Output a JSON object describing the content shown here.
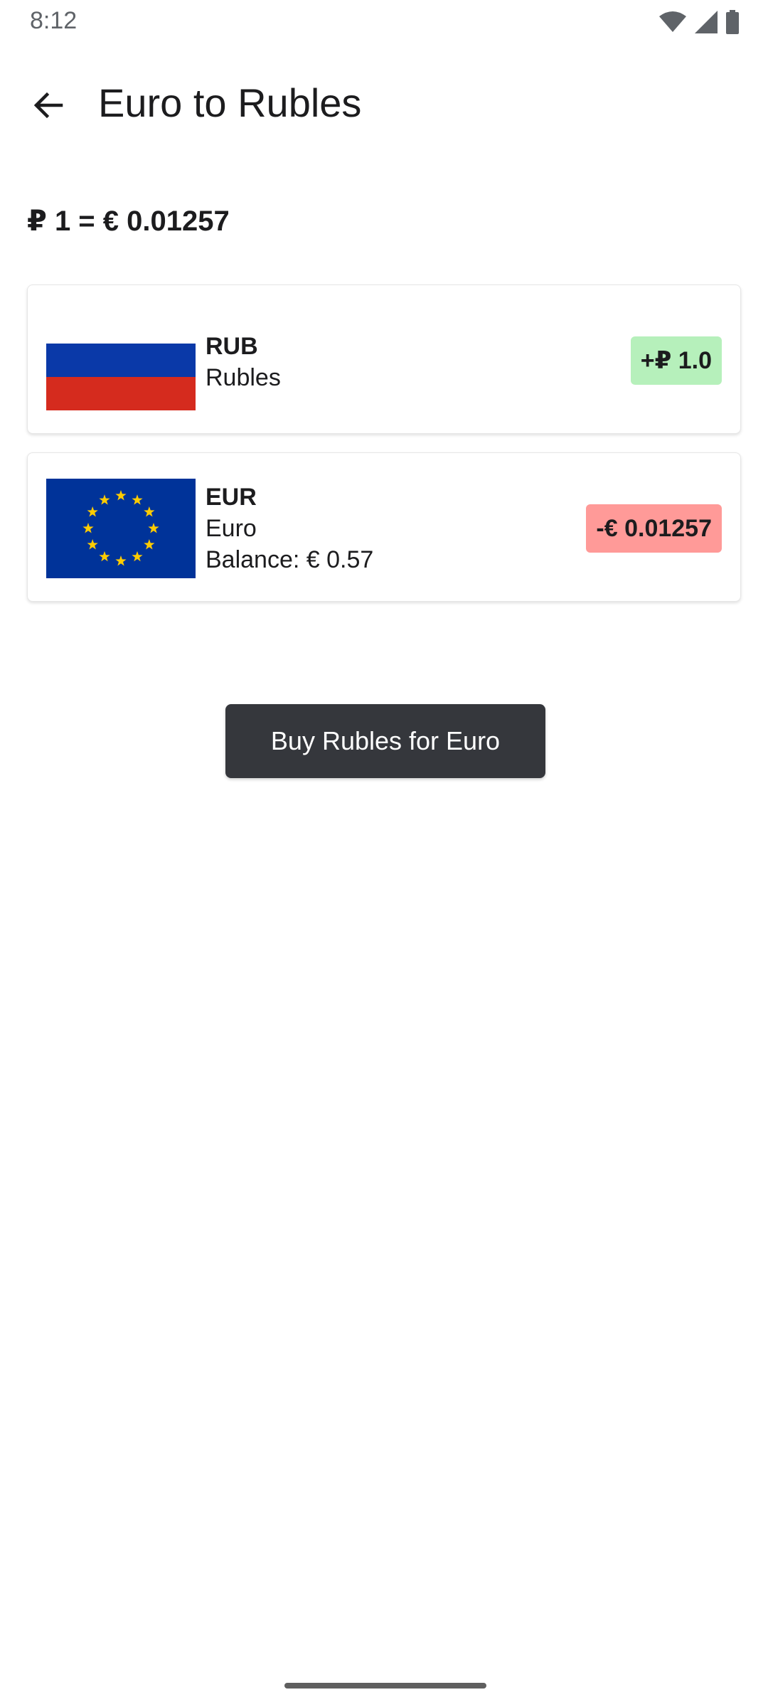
{
  "status_bar": {
    "time": "8:12",
    "icons": [
      "wifi-icon",
      "signal-icon",
      "battery-icon"
    ]
  },
  "app_bar": {
    "back_icon": "arrow-back-icon",
    "title": "Euro to Rubles"
  },
  "rate": {
    "text": "₽ 1 = € 0.01257"
  },
  "cards": [
    {
      "flag": "russia-flag",
      "code": "RUB",
      "name": "Rubles",
      "amount": "+₽ 1.0",
      "amount_color": "#b6f0bb"
    },
    {
      "flag": "eu-flag",
      "code": "EUR",
      "name": "Euro",
      "balance": "Balance: € 0.57",
      "amount": "-€ 0.01257",
      "amount_color": "#ff9a98"
    }
  ],
  "action": {
    "label": "Buy Rubles for Euro"
  },
  "colors": {
    "button_bg": "#35373c",
    "rub_blue": "#0a39a8",
    "rub_red": "#d52b1e",
    "eu_blue": "#003399",
    "eu_star": "#ffcc00"
  }
}
